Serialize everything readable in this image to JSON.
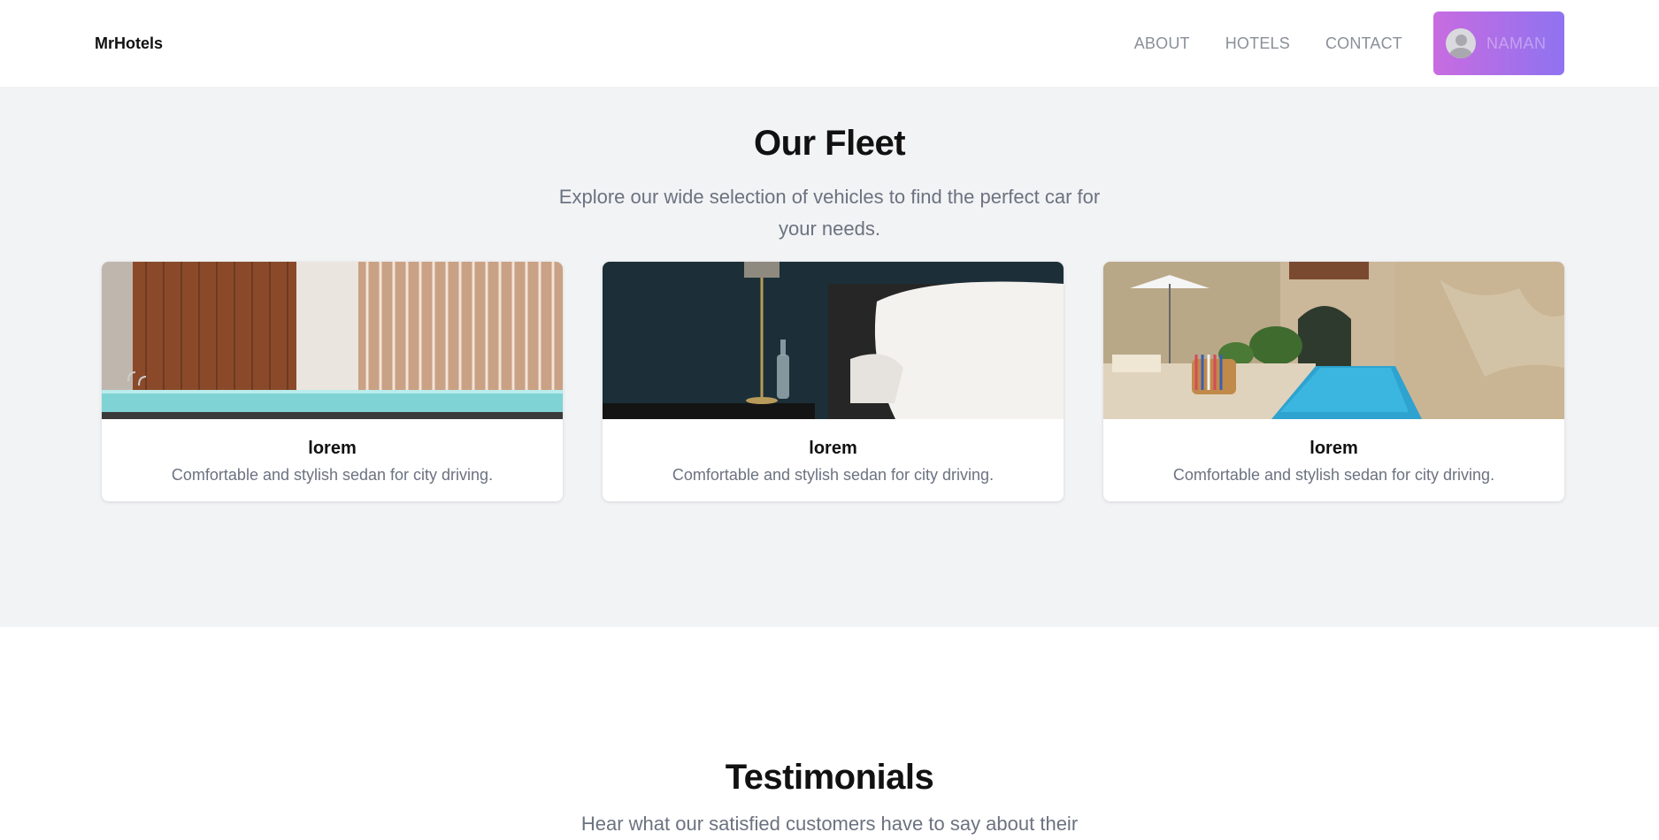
{
  "nav": {
    "brand": "MrHotels",
    "links": [
      "ABOUT",
      "HOTELS",
      "CONTACT"
    ],
    "user": {
      "name": "NAMAN",
      "icon": "user-avatar-icon",
      "gradient": [
        "#c86be0",
        "#8f73f0"
      ]
    }
  },
  "fleet": {
    "title": "Our Fleet",
    "subtitle": "Explore our wide selection of vehicles to find the perfect car for your needs.",
    "cards": [
      {
        "title": "lorem",
        "description": "Comfortable and stylish sedan for city driving.",
        "image": "indoor-pool-photo"
      },
      {
        "title": "lorem",
        "description": "Comfortable and stylish sedan for city driving.",
        "image": "bedroom-pillow-photo"
      },
      {
        "title": "lorem",
        "description": "Comfortable and stylish sedan for city driving.",
        "image": "courtyard-pool-photo"
      }
    ]
  },
  "testimonials": {
    "title": "Testimonials",
    "subtitle": "Hear what our satisfied customers have to say about their"
  },
  "colors": {
    "section_bg": "#f2f3f5",
    "muted_text": "#6b7280",
    "nav_link": "#8a8f98"
  }
}
